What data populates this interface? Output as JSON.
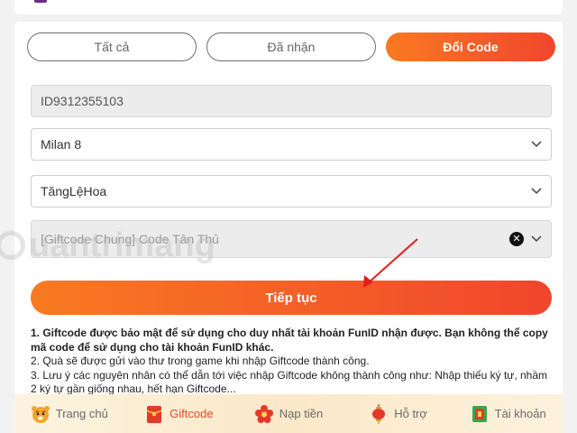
{
  "tabs": [
    {
      "label": "Tất cả",
      "active": false
    },
    {
      "label": "Đã nhận",
      "active": false
    },
    {
      "label": "Đổi Code",
      "active": true
    }
  ],
  "form": {
    "user_id": "ID9312355103",
    "server": "Milan 8",
    "character": "TăngLệHoa",
    "giftcode": "[Giftcode Chung] Code Tân Thủ",
    "submit_label": "Tiếp tục"
  },
  "notes": {
    "line1": "1. Giftcode được bảo mật để sử dụng cho duy nhất tài khoản FunID nhận được. Bạn không thể copy mã code để sử dụng cho tài khoản FunID khác.",
    "line2": "2. Quà sẽ được gửi vào thư trong game khi nhập Giftcode thành công.",
    "line3": "3. Lưu ý các nguyên nhân có thể dẫn tới việc nhập Giftcode không thành công như: Nhập thiếu ký tự, nhầm 2 ký tự gần giống nhau, hết hạn Giftcode..."
  },
  "watermark": "uantrimang",
  "bottom_nav": [
    {
      "label": "Trang chủ",
      "icon": "tiger-icon",
      "active": false
    },
    {
      "label": "Giftcode",
      "icon": "red-envelope-icon",
      "active": true
    },
    {
      "label": "Nạp tiền",
      "icon": "flower-icon",
      "active": false
    },
    {
      "label": "Hỗ trợ",
      "icon": "lantern-icon",
      "active": false
    },
    {
      "label": "Tài khoản",
      "icon": "account-card-icon",
      "active": false
    }
  ],
  "colors": {
    "accent_start": "#f97a22",
    "accent_end": "#f0462c",
    "annotation_arrow": "#e02020"
  }
}
